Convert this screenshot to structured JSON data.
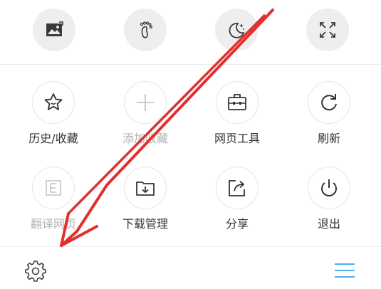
{
  "top_toolbar": {
    "buttons": [
      {
        "name": "image-mode",
        "icon": "image-icon"
      },
      {
        "name": "footprint",
        "icon": "footprint-icon"
      },
      {
        "name": "night-mode",
        "icon": "moon-stars-icon"
      },
      {
        "name": "fullscreen",
        "icon": "expand-arrows-icon"
      }
    ]
  },
  "menu": {
    "items": [
      {
        "label": "历史/收藏",
        "icon": "star-icon",
        "enabled": true
      },
      {
        "label": "添加收藏",
        "icon": "plus-icon",
        "enabled": false
      },
      {
        "label": "网页工具",
        "icon": "toolbox-icon",
        "enabled": true
      },
      {
        "label": "刷新",
        "icon": "refresh-icon",
        "enabled": true
      },
      {
        "label": "翻译网页",
        "icon": "translate-icon",
        "enabled": false
      },
      {
        "label": "下载管理",
        "icon": "download-folder-icon",
        "enabled": true
      },
      {
        "label": "分享",
        "icon": "share-icon",
        "enabled": true
      },
      {
        "label": "退出",
        "icon": "power-icon",
        "enabled": true
      }
    ]
  },
  "bottom_bar": {
    "settings_icon": "gear-icon",
    "menu_icon": "hamburger-icon"
  },
  "colors": {
    "icon_dark": "#333333",
    "icon_disabled": "#c4c4c4",
    "top_button_bg": "#eeeeee",
    "accent_blue": "#3aa0ee",
    "annotation_red": "#e03030"
  }
}
